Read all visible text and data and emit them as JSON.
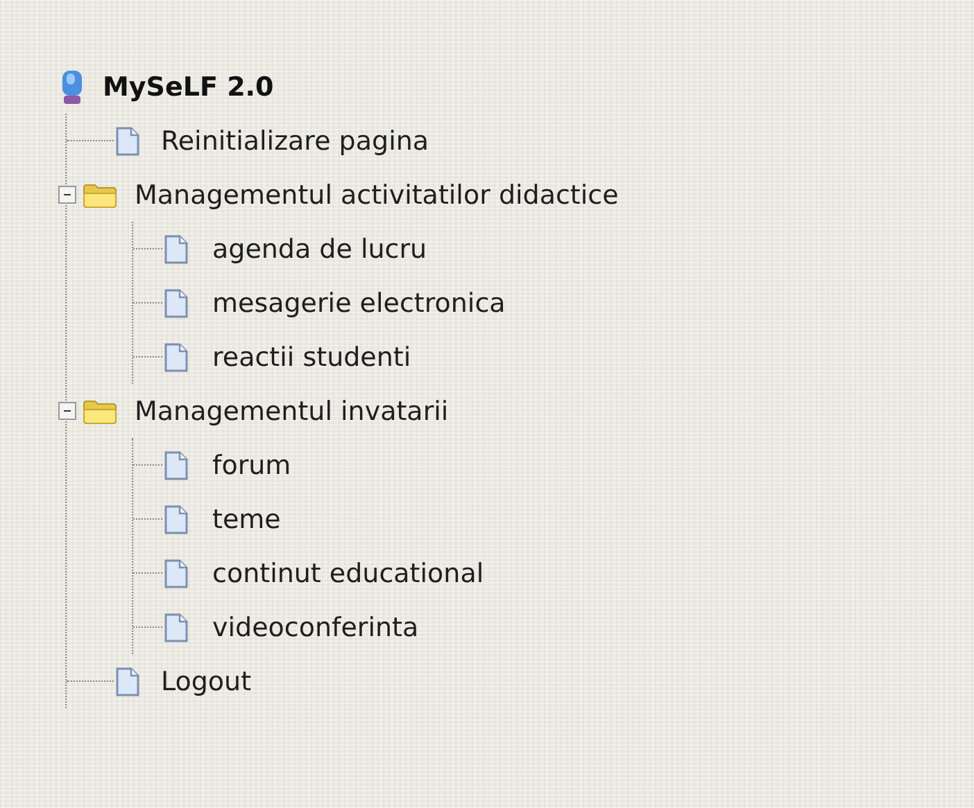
{
  "tree": {
    "label": "MySeLF 2.0",
    "children": [
      {
        "kind": "page",
        "label": "Reinitializare pagina"
      },
      {
        "kind": "folder",
        "label": "Managementul activitatilor didactice",
        "expanded": true,
        "children": [
          {
            "kind": "page",
            "label": "agenda de lucru"
          },
          {
            "kind": "page",
            "label": "mesagerie electronica"
          },
          {
            "kind": "page",
            "label": "reactii studenti"
          }
        ]
      },
      {
        "kind": "folder",
        "label": "Managementul invatarii",
        "expanded": true,
        "children": [
          {
            "kind": "page",
            "label": "forum"
          },
          {
            "kind": "page",
            "label": "teme"
          },
          {
            "kind": "page",
            "label": "continut educational"
          },
          {
            "kind": "page",
            "label": "videoconferinta"
          }
        ]
      },
      {
        "kind": "page",
        "label": "Logout"
      }
    ]
  }
}
